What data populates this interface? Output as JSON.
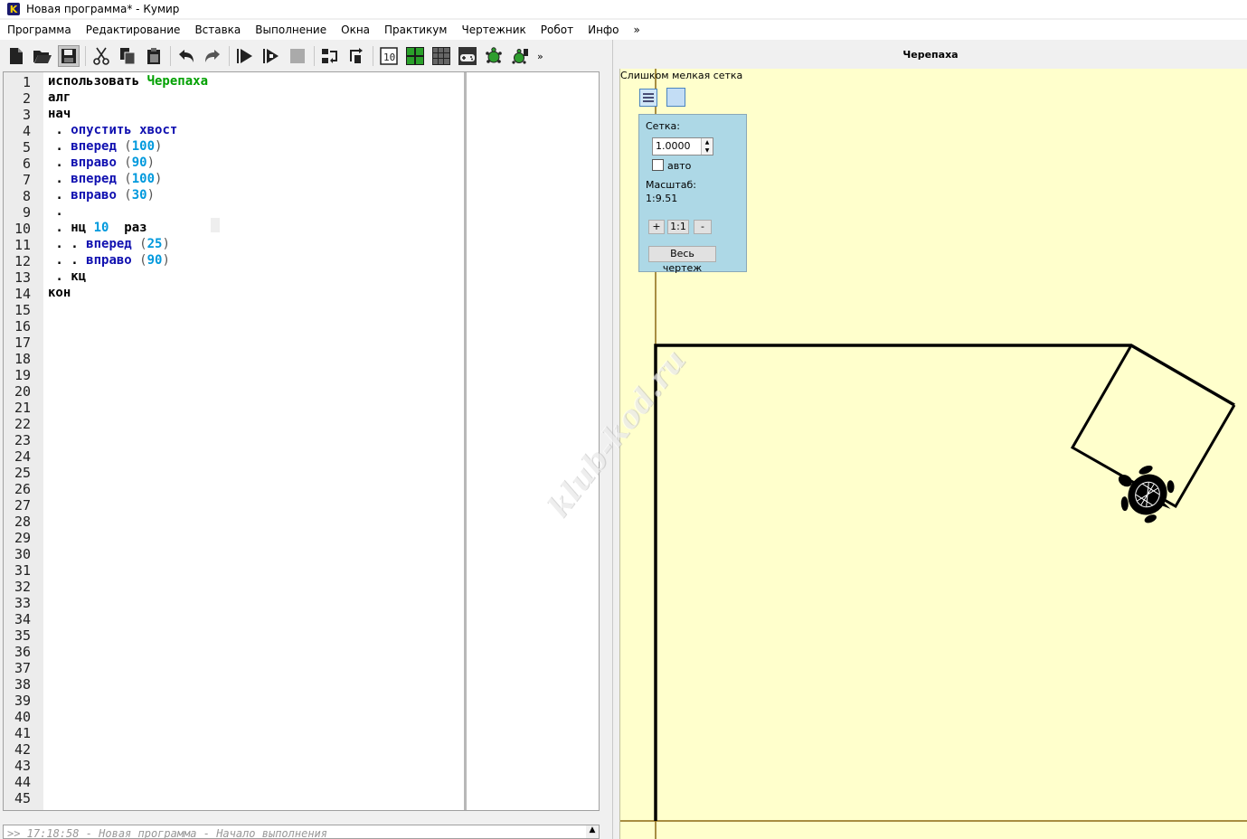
{
  "window": {
    "title": "Новая программа* - Кумир",
    "logo_letter": "K"
  },
  "menu": [
    "Программа",
    "Редактирование",
    "Вставка",
    "Выполнение",
    "Окна",
    "Практикум",
    "Чертежник",
    "Робот",
    "Инфо",
    "»"
  ],
  "toolbar": {
    "more": "»",
    "icons": [
      "new-file-icon",
      "open-folder-icon",
      "save-icon",
      "cut-icon",
      "copy-icon",
      "paste-icon",
      "undo-icon",
      "redo-icon",
      "run-icon",
      "step-run-icon",
      "stop-icon",
      "step-into-icon",
      "step-out-icon",
      "counter-icon",
      "grid-green-icon",
      "grid-dark-icon",
      "gamepad-icon",
      "turtle-icon",
      "robot-turtle-icon"
    ]
  },
  "editor": {
    "line_numbers": [
      "1",
      "2",
      "3",
      "4",
      "5",
      "6",
      "7",
      "8",
      "9",
      "10",
      "11",
      "12",
      "13",
      "14",
      "15",
      "16",
      "17",
      "18",
      "19",
      "20",
      "21",
      "22",
      "23",
      "24",
      "25",
      "26",
      "27",
      "28",
      "29",
      "30",
      "31",
      "32",
      "33",
      "34",
      "35",
      "36",
      "37",
      "38",
      "39",
      "40",
      "41",
      "42",
      "43",
      "44",
      "45"
    ],
    "code": [
      [
        {
          "t": "использовать ",
          "c": "kw"
        },
        {
          "t": "Черепаха",
          "c": "mod"
        }
      ],
      [
        {
          "t": "алг",
          "c": "kw"
        }
      ],
      [
        {
          "t": "нач",
          "c": "kw"
        }
      ],
      [
        {
          "t": " . ",
          "c": "kw"
        },
        {
          "t": "опустить хвост",
          "c": "cmd"
        }
      ],
      [
        {
          "t": " . ",
          "c": "kw"
        },
        {
          "t": "вперед",
          "c": "cmd"
        },
        {
          "t": " (",
          "c": "paren"
        },
        {
          "t": "100",
          "c": "num"
        },
        {
          "t": ")",
          "c": "paren"
        }
      ],
      [
        {
          "t": " . ",
          "c": "kw"
        },
        {
          "t": "вправо",
          "c": "cmd"
        },
        {
          "t": " (",
          "c": "paren"
        },
        {
          "t": "90",
          "c": "num"
        },
        {
          "t": ")",
          "c": "paren"
        }
      ],
      [
        {
          "t": " . ",
          "c": "kw"
        },
        {
          "t": "вперед",
          "c": "cmd"
        },
        {
          "t": " (",
          "c": "paren"
        },
        {
          "t": "100",
          "c": "num"
        },
        {
          "t": ")",
          "c": "paren"
        }
      ],
      [
        {
          "t": " . ",
          "c": "kw"
        },
        {
          "t": "вправо",
          "c": "cmd"
        },
        {
          "t": " (",
          "c": "paren"
        },
        {
          "t": "30",
          "c": "num"
        },
        {
          "t": ")",
          "c": "paren"
        }
      ],
      [
        {
          "t": " .",
          "c": "kw"
        }
      ],
      [
        {
          "t": " . нц ",
          "c": "kw"
        },
        {
          "t": "10",
          "c": "num"
        },
        {
          "t": "  раз",
          "c": "kw"
        }
      ],
      [
        {
          "t": " . . ",
          "c": "kw"
        },
        {
          "t": "вперед",
          "c": "cmd"
        },
        {
          "t": " (",
          "c": "paren"
        },
        {
          "t": "25",
          "c": "num"
        },
        {
          "t": ")",
          "c": "paren"
        }
      ],
      [
        {
          "t": " . . ",
          "c": "kw"
        },
        {
          "t": "вправо",
          "c": "cmd"
        },
        {
          "t": " (",
          "c": "paren"
        },
        {
          "t": "90",
          "c": "num"
        },
        {
          "t": ")",
          "c": "paren"
        }
      ],
      [
        {
          "t": " . кц",
          "c": "kw"
        }
      ],
      [
        {
          "t": "кон",
          "c": "kw"
        }
      ]
    ]
  },
  "console": {
    "text": ">> 17:18:58 - Новая программа - Начало выполнения"
  },
  "turtle_panel": {
    "title": "Черепаха",
    "grid_warning": "Слишком мелкая сетка",
    "grid_label": "Сетка:",
    "grid_value": "1.0000",
    "auto_label": "авто",
    "scale_label": "Масштаб:",
    "scale_value": "1:9.51",
    "zoom_in": "+",
    "zoom_reset": "1:1",
    "zoom_out": "-",
    "fit_all": "Весь чертеж",
    "canvas_color": "#ffffcc"
  },
  "watermark": "klub-kod.ru"
}
